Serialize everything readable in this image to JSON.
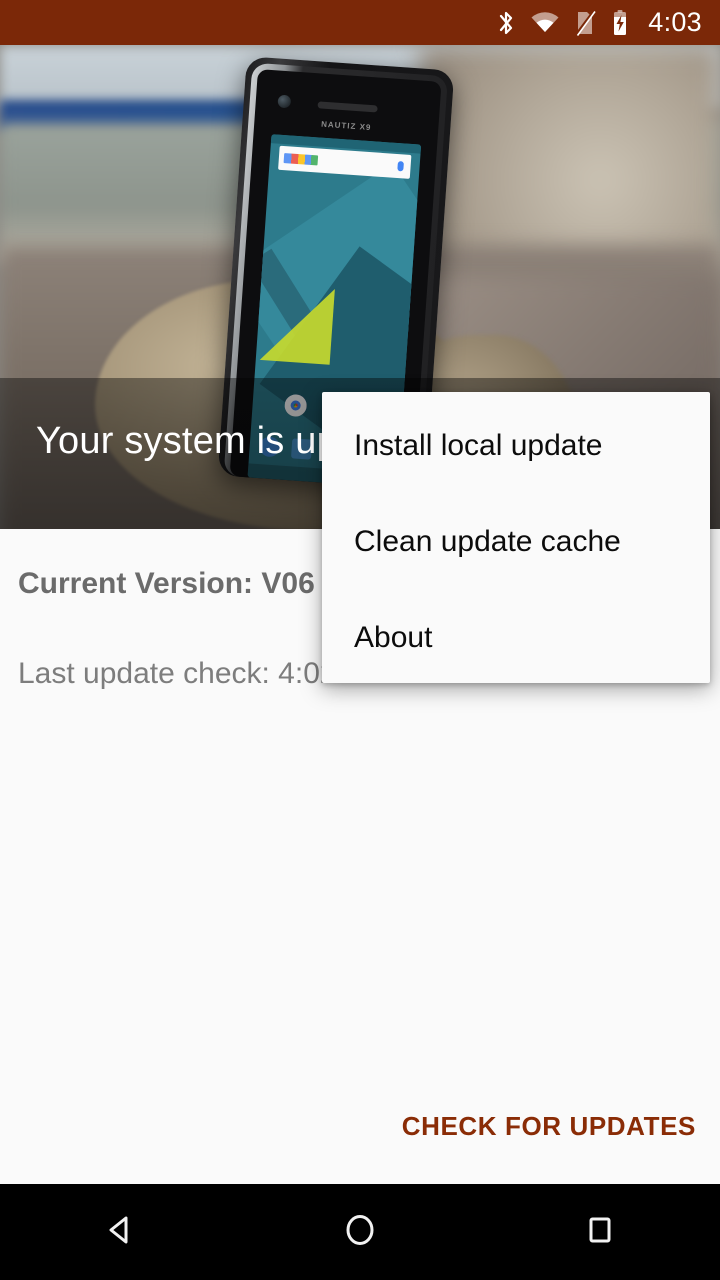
{
  "status_bar": {
    "background_color": "#7B2808",
    "time": "4:03",
    "icons": [
      {
        "name": "bluetooth-icon"
      },
      {
        "name": "wifi-icon"
      },
      {
        "name": "no-sim-icon"
      },
      {
        "name": "battery-charging-icon"
      }
    ]
  },
  "hero": {
    "title": "Your system is up to date",
    "image_alt": "rugged smartphone propped on a rock outdoors",
    "phone_brand": "NAUTIZ X9"
  },
  "main": {
    "current_version": "Current Version: V06",
    "last_update_check": "Last update check: 4:02 PM",
    "check_button": "CHECK FOR UPDATES",
    "accent_color": "#8A2C06",
    "background_color": "#FAFAFA"
  },
  "popup_menu": {
    "items": [
      {
        "label": "Install local update"
      },
      {
        "label": "Clean update cache"
      },
      {
        "label": "About"
      }
    ]
  },
  "nav_bar": {
    "background_color": "#000000",
    "buttons": [
      {
        "name": "back-button",
        "icon": "triangle-left-icon"
      },
      {
        "name": "home-button",
        "icon": "circle-icon"
      },
      {
        "name": "recents-button",
        "icon": "square-icon"
      }
    ]
  }
}
